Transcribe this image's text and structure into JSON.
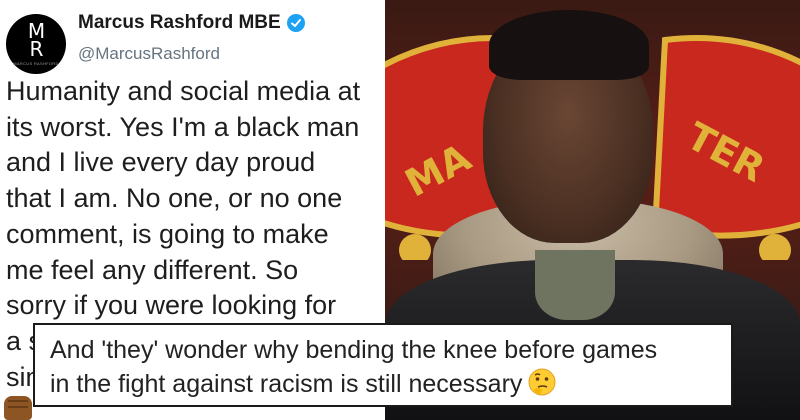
{
  "tweet": {
    "display_name": "Marcus Rashford MBE",
    "handle": "@MarcusRashford",
    "avatar": {
      "monogram": "M\nR",
      "caption": "MARCUS RASHFORD"
    },
    "verified_icon": "verified-badge-icon",
    "lines": [
      "Humanity and social media at",
      "its worst. Yes I'm a black man",
      "and I live every day proud",
      "that I am. No one, or no one",
      "comment, is going to make",
      "me feel any different. So",
      "sorry if you were looking for",
      "a s",
      "sin"
    ],
    "emoji": "raised-fist-medium-dark-skin-icon"
  },
  "photo": {
    "crest_text": [
      "MA",
      "TER"
    ],
    "colors": {
      "crest_red": "#c8281e",
      "crest_gold": "#e0b23a"
    }
  },
  "caption": {
    "lines": [
      "And 'they' wonder why bending the knee before games",
      "in the fight against racism is still necessary"
    ],
    "emoji": "thinking-face-icon"
  }
}
